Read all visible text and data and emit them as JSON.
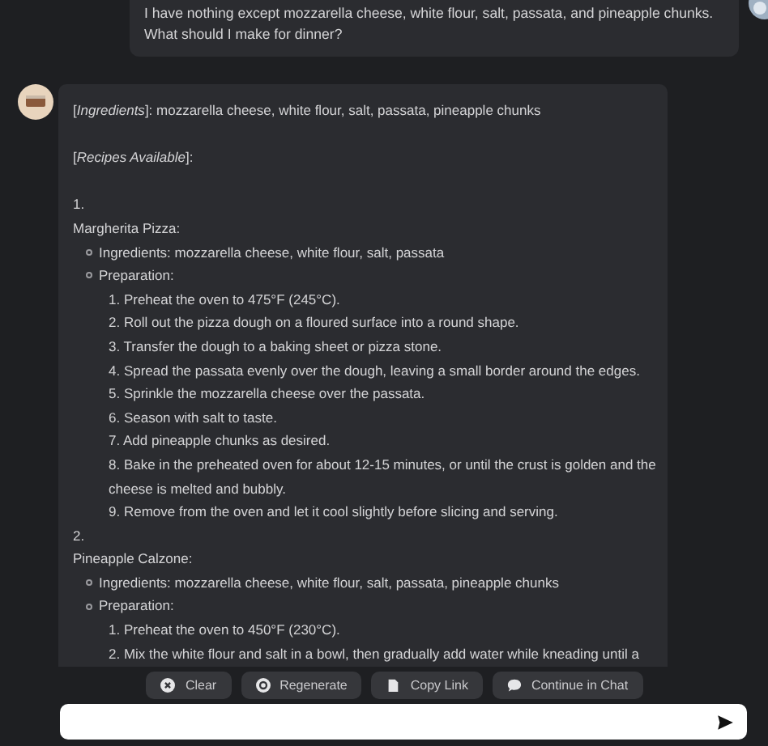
{
  "user_message": {
    "text": "I have nothing except mozzarella cheese, white flour, salt, passata, and pineapple chunks. What should I make for dinner?"
  },
  "response": {
    "ingredients_line": "[*Ingredients*]: mozzarella cheese, white flour, salt, passata, pineapple chunks",
    "recipes_line": "[*Recipes Available*]:",
    "recipes": [
      {
        "number": "1.",
        "name": "Margherita Pizza:",
        "ingredients": "Ingredients: mozzarella cheese, white flour, salt, passata",
        "preparation_label": "Preparation:",
        "steps": [
          "1. Preheat the oven to 475°F (245°C).",
          "2. Roll out the pizza dough on a floured surface into a round shape.",
          "3. Transfer the dough to a baking sheet or pizza stone.",
          "4. Spread the passata evenly over the dough, leaving a small border around the edges.",
          "5. Sprinkle the mozzarella cheese over the passata.",
          "6. Season with salt to taste.",
          "7. Add pineapple chunks as desired.",
          "8. Bake in the preheated oven for about 12-15 minutes, or until the crust is golden and the cheese is melted and bubbly.",
          "9. Remove from the oven and let it cool slightly before slicing and serving."
        ]
      },
      {
        "number": "2.",
        "name": "Pineapple Calzone:",
        "ingredients": "Ingredients: mozzarella cheese, white flour, salt, passata, pineapple chunks",
        "preparation_label": "Preparation:",
        "steps": [
          "1. Preheat the oven to 450°F (230°C).",
          "2. Mix the white flour and salt in a bowl, then gradually add water while kneading until a"
        ]
      }
    ]
  },
  "actions": [
    {
      "label": "Clear",
      "kind": "clear"
    },
    {
      "label": "Regenerate",
      "kind": "regenerate"
    },
    {
      "label": "Copy Link",
      "kind": "copy"
    },
    {
      "label": "Continue in Chat",
      "kind": "chat"
    }
  ]
}
